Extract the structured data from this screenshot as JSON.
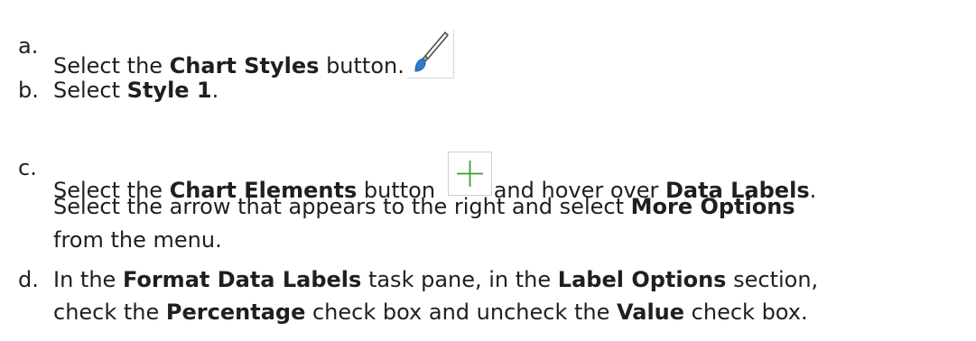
{
  "steps": [
    {
      "marker": "a.",
      "text1": "Select the ",
      "bold1": "Chart Styles",
      "text2": " button."
    },
    {
      "marker": "b.",
      "text1": "Select ",
      "bold1": "Style 1",
      "text2": "."
    },
    {
      "marker": "c.",
      "text1": "Select the ",
      "bold1": "Chart Elements",
      "text2": " button ",
      "text3": "and hover over ",
      "bold2": "Data Labels",
      "text4": ".",
      "line2_text1": "Select the arrow that appears to the right and select ",
      "line2_bold1": "More Options",
      "line3_text1": "from the menu."
    },
    {
      "marker": "d.",
      "text1": "In the ",
      "bold1": "Format Data Labels",
      "text2": " task pane, in the ",
      "bold2": "Label Options",
      "text3": " section,",
      "line2_text1": "check the ",
      "line2_bold1": "Percentage",
      "line2_text2": " check box and uncheck the ",
      "line2_bold2": "Value",
      "line2_text3": " check box."
    }
  ],
  "icons": {
    "chart_styles": "paintbrush-icon",
    "chart_elements": "plus-icon"
  },
  "colors": {
    "text": "#1f1f1f",
    "brush_blue": "#2e7ad1",
    "plus_green": "#3a9e3a"
  }
}
